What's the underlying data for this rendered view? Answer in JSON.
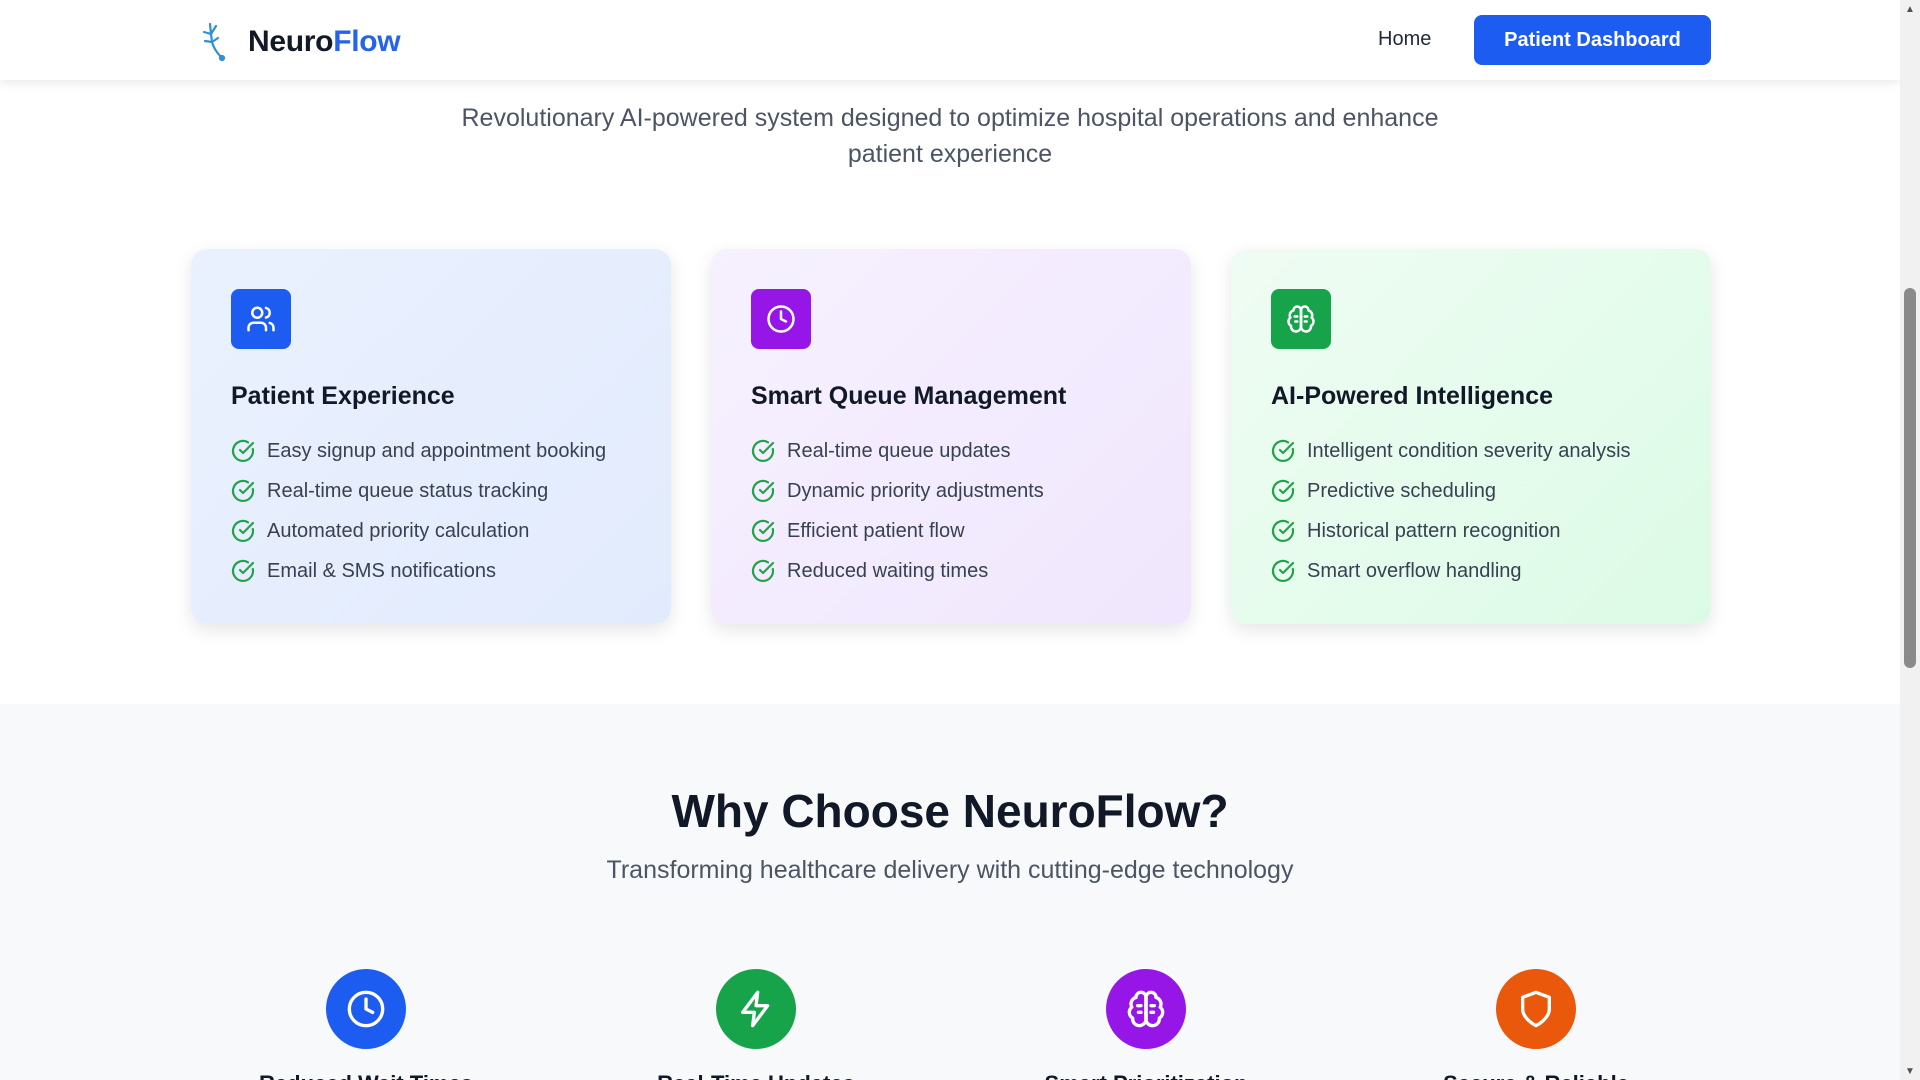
{
  "brand": {
    "name_part1": "Neuro",
    "name_part2": "Flow",
    "icon": "logo-icon",
    "accent": "#2563eb"
  },
  "nav": {
    "home": "Home",
    "cta": "Patient Dashboard"
  },
  "hero": {
    "subtitle": "Revolutionary AI-powered system designed to optimize hospital operations and enhance patient experience"
  },
  "features": [
    {
      "title": "Patient Experience",
      "icon": "users-icon",
      "color": "#1d5cf0",
      "items": [
        "Easy signup and appointment booking",
        "Real-time queue status tracking",
        "Automated priority calculation",
        "Email & SMS notifications"
      ]
    },
    {
      "title": "Smart Queue Management",
      "icon": "clock-icon",
      "color": "#9616e8",
      "items": [
        "Real-time queue updates",
        "Dynamic priority adjustments",
        "Efficient patient flow",
        "Reduced waiting times"
      ]
    },
    {
      "title": "AI-Powered Intelligence",
      "icon": "brain-icon",
      "color": "#16a34a",
      "items": [
        "Intelligent condition severity analysis",
        "Predictive scheduling",
        "Historical pattern recognition",
        "Smart overflow handling"
      ]
    }
  ],
  "why": {
    "title": "Why Choose NeuroFlow?",
    "subtitle": "Transforming healthcare delivery with cutting-edge technology",
    "benefits": [
      {
        "icon": "clock-icon",
        "color": "#1d5cf0",
        "title": "Reduced Wait Times"
      },
      {
        "icon": "zap-icon",
        "color": "#16a34a",
        "title": "Real-Time Updates"
      },
      {
        "icon": "brain-icon",
        "color": "#9616e8",
        "title": "Smart Prioritization"
      },
      {
        "icon": "shield-icon",
        "color": "#ea580c",
        "title": "Secure & Reliable"
      }
    ]
  }
}
